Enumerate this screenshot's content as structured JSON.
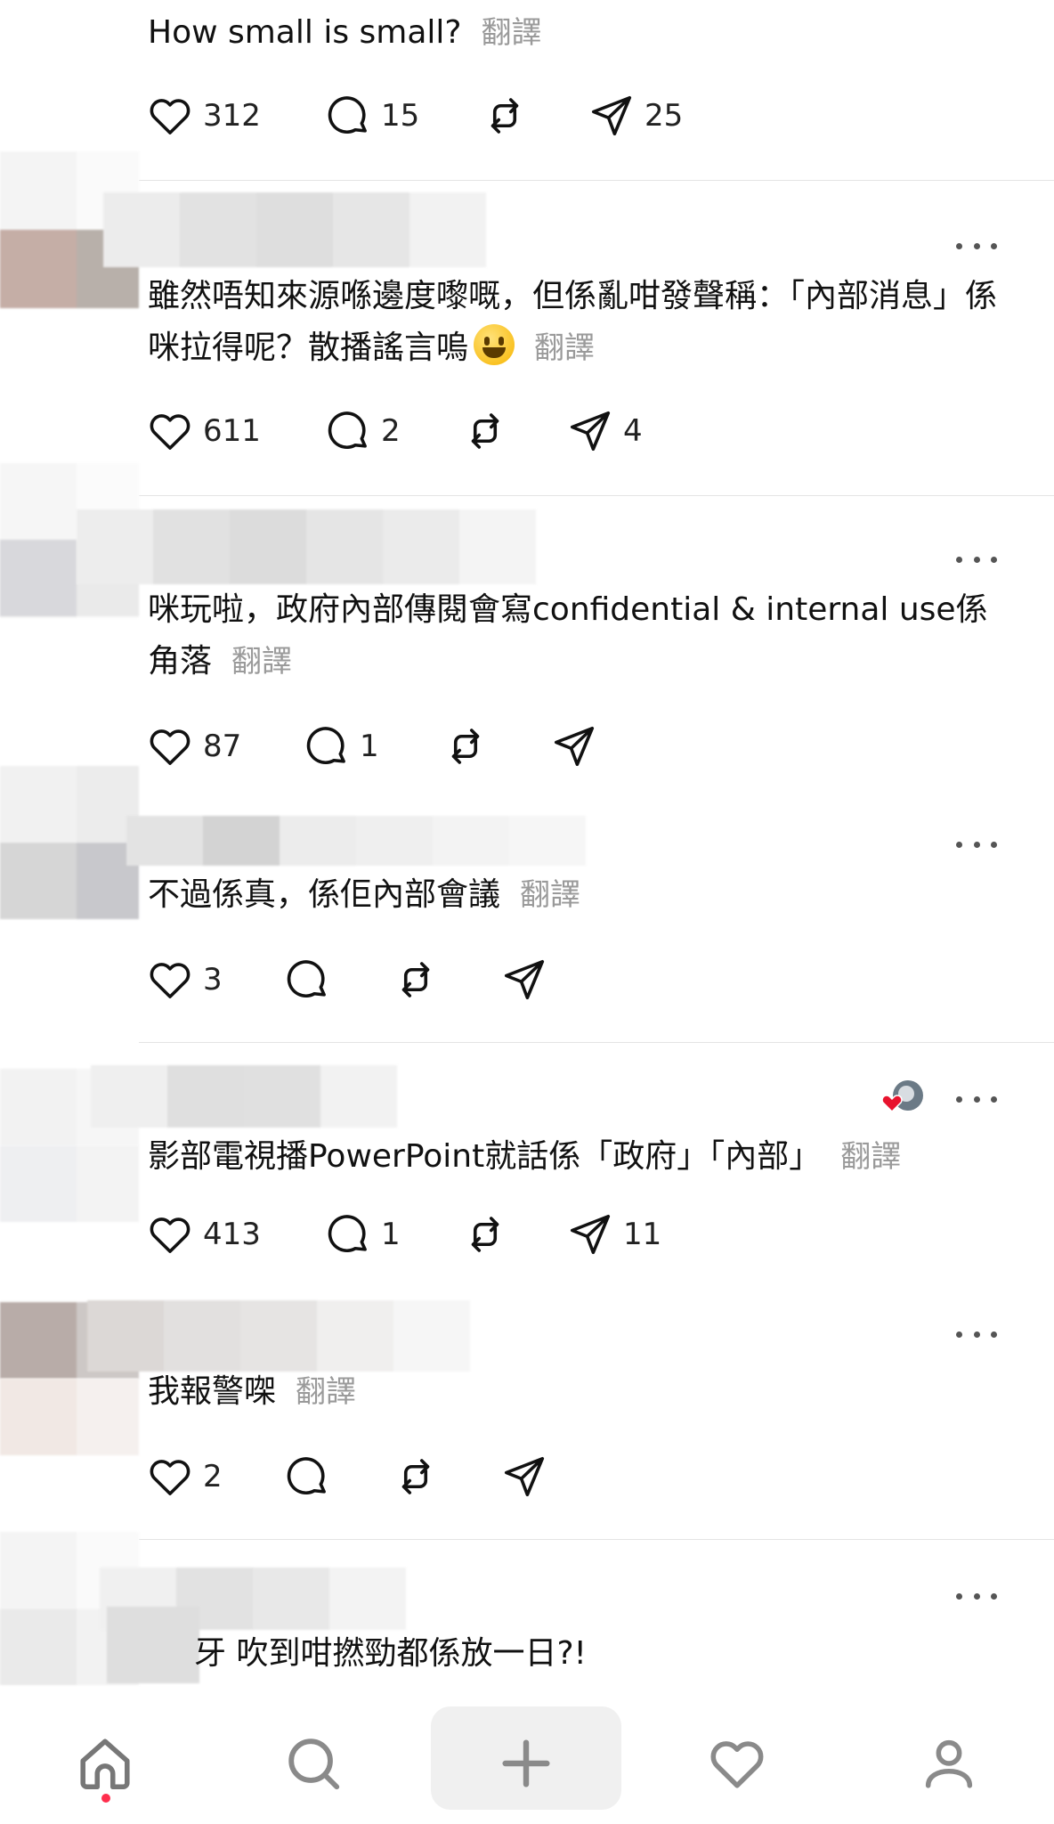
{
  "translate_label": "翻譯",
  "posts": [
    {
      "text": "How small is small?",
      "likes": "312",
      "replies": "15",
      "shares": "25"
    },
    {
      "text": "雖然唔知來源喺邊度嚟嘅，但係亂咁發聲稱：「內部消息」係咪拉得呢？散播謠言嗚",
      "emoji": "grinning-face-emoji",
      "likes": "611",
      "replies": "2",
      "shares": "4"
    },
    {
      "text": "咪玩啦，政府內部傳閱會寫confidential & internal use係角落",
      "likes": "87",
      "replies": "1",
      "shares": ""
    },
    {
      "text": "不過係真，係佢內部會議",
      "likes": "3",
      "replies": "",
      "shares": ""
    },
    {
      "text": "影部電視播PowerPoint就話係「政府」「內部」",
      "likes": "413",
      "replies": "1",
      "shares": "11"
    },
    {
      "text": "我報警㗎",
      "likes": "2",
      "replies": "",
      "shares": ""
    },
    {
      "text": "牙 吹到咁撚勁都係放一日?!"
    }
  ],
  "nav": {
    "items": [
      "home-icon",
      "search-icon",
      "compose-icon",
      "activity-heart-icon",
      "profile-icon"
    ],
    "active": "home"
  },
  "colors": {
    "notify_dot": "#ff2e4d",
    "muted_text": "#9a9a9a"
  }
}
